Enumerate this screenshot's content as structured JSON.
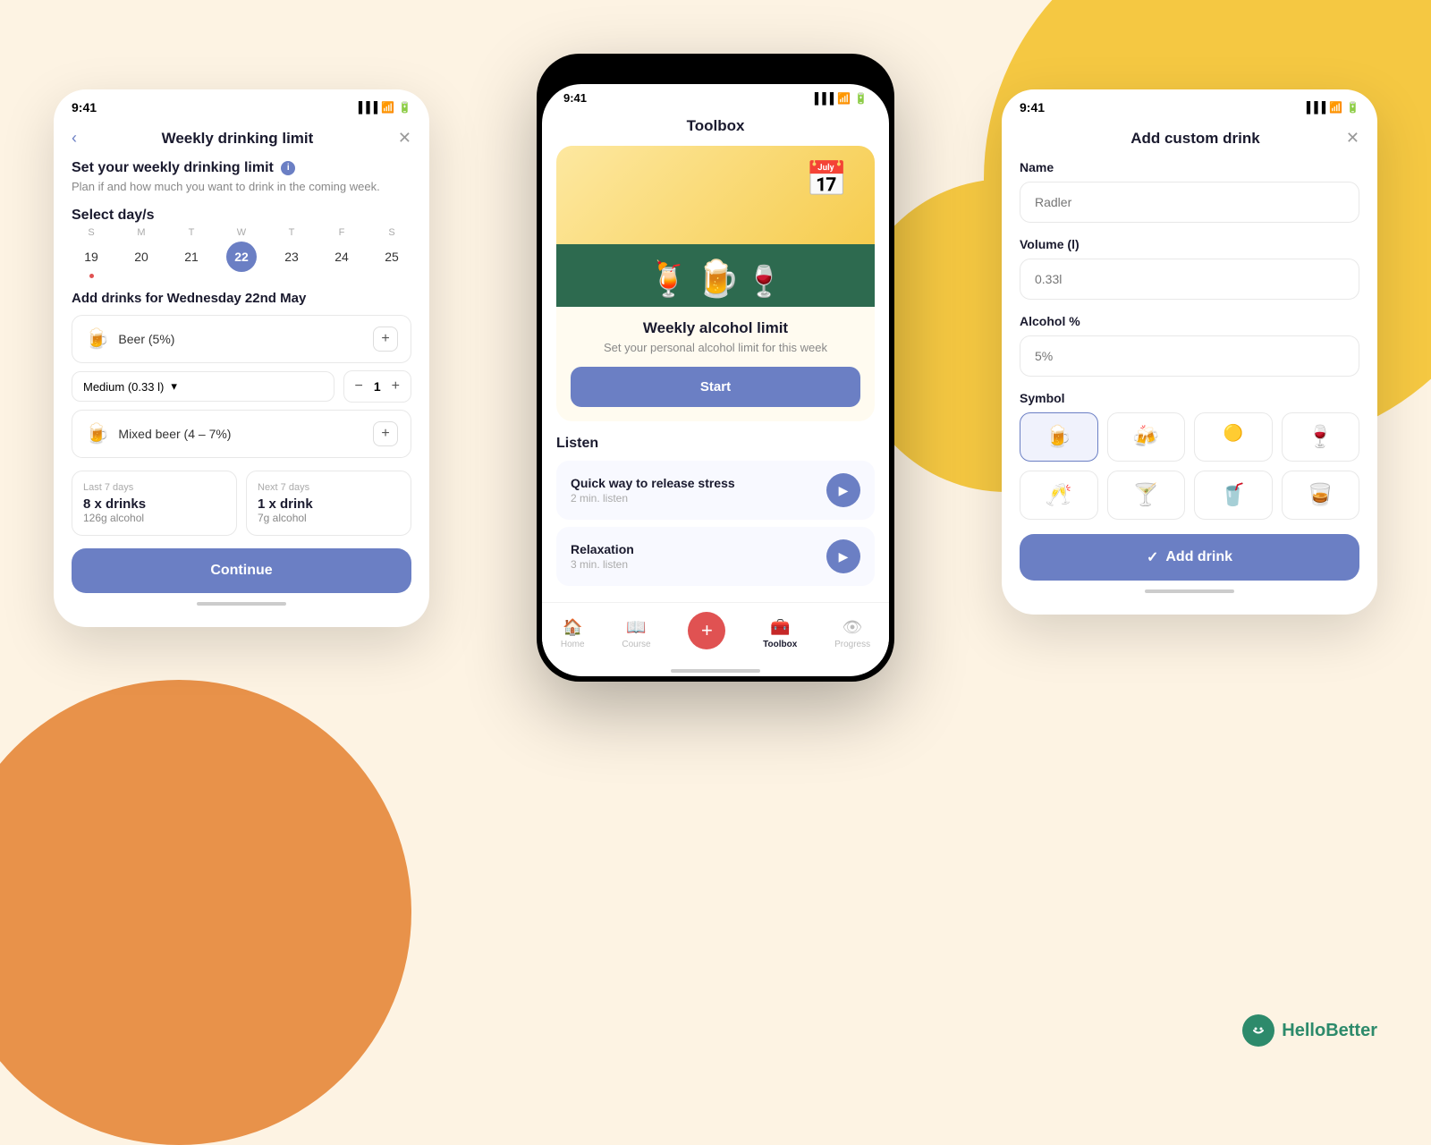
{
  "background": {
    "color": "#fdf3e3"
  },
  "left_phone": {
    "status_time": "9:41",
    "header_title": "Weekly drinking limit",
    "back_label": "‹",
    "close_label": "✕",
    "set_limit_title": "Set your weekly drinking limit",
    "set_limit_subtitle": "Plan if and how much you want to drink in the coming week.",
    "select_days_title": "Select day/s",
    "calendar": {
      "days": [
        "S",
        "M",
        "T",
        "W",
        "T",
        "F",
        "S"
      ],
      "dates": [
        "19",
        "20",
        "21",
        "22",
        "23",
        "24",
        "25"
      ],
      "selected_index": 3,
      "dot_index": 0
    },
    "add_drinks_title": "Add drinks for Wednesday 22nd May",
    "drinks": [
      {
        "icon": "🍺",
        "label": "Beer (5%)"
      },
      {
        "icon": "🍺",
        "label": "Mixed beer (4 – 7%)"
      }
    ],
    "size_select": "Medium (0.33 l)",
    "quantity": "1",
    "stats": {
      "last_period": "Last 7 days",
      "last_drinks": "8 x drinks",
      "last_alcohol": "126g alcohol",
      "next_period": "Next 7 days",
      "next_drinks": "1 x drink",
      "next_alcohol": "7g alcohol"
    },
    "continue_btn": "Continue"
  },
  "center_phone": {
    "status_time": "9:41",
    "toolbox_title": "Toolbox",
    "wal_card": {
      "title": "Weekly alcohol limit",
      "subtitle": "Set your personal alcohol limit for this week",
      "start_btn": "Start"
    },
    "listen_title": "Listen",
    "listen_items": [
      {
        "name": "Quick way to release stress",
        "duration": "2 min. listen"
      },
      {
        "name": "Relaxation",
        "duration": "3 min. listen"
      }
    ],
    "nav": {
      "items": [
        {
          "icon": "🏠",
          "label": "Home",
          "active": false
        },
        {
          "icon": "📖",
          "label": "Course",
          "active": false
        },
        {
          "icon": "+",
          "label": "",
          "is_add": true
        },
        {
          "icon": "🧰",
          "label": "Toolbox",
          "active": true
        },
        {
          "icon": "👁",
          "label": "Progress",
          "active": false
        }
      ]
    }
  },
  "right_phone": {
    "status_time": "9:41",
    "header_title": "Add custom drink",
    "close_label": "✕",
    "name_label": "Name",
    "name_placeholder": "Radler",
    "volume_label": "Volume (l)",
    "volume_placeholder": "0.33l",
    "alcohol_label": "Alcohol %",
    "alcohol_placeholder": "5%",
    "symbol_label": "Symbol",
    "symbols": [
      "🍺",
      "🍻",
      "🟡",
      "🍷",
      "🥂",
      "🍸",
      "🥤",
      "🥃"
    ],
    "selected_symbol_index": 0,
    "add_btn": "Add drink",
    "add_btn_check": "✓"
  },
  "logo": {
    "text": "HelloBetter",
    "icon": "😊"
  }
}
